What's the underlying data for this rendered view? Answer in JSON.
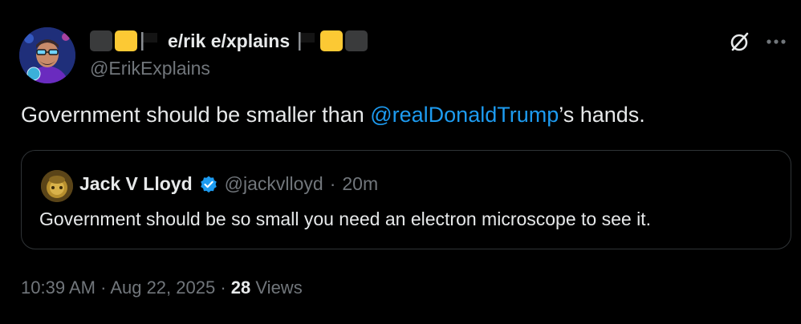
{
  "colors": {
    "background": "#000000",
    "text_primary": "#e7e9ea",
    "text_secondary": "#71767b",
    "link": "#1d9bf0",
    "verified": "#1d9bf0",
    "emoji_black": "#3a3b3c",
    "emoji_yellow": "#fcc934",
    "border": "#2f3336"
  },
  "tweet": {
    "author": {
      "display_name": "e/rik e/xplains",
      "handle": "@ErikExplains",
      "name_prefix_emoji": [
        "black-square-emoji",
        "yellow-square-emoji",
        "black-flag-emoji"
      ],
      "name_suffix_emoji": [
        "black-flag-emoji",
        "yellow-square-emoji",
        "black-square-emoji"
      ]
    },
    "icons": {
      "grok": "grok-icon",
      "more": "more-icon"
    },
    "text_before": "Government should be smaller than ",
    "mention": "@realDonaldTrump",
    "text_after": "’s hands.",
    "quoted": {
      "display_name": "Jack V Lloyd",
      "verified_icon": "verified-badge-icon",
      "handle": "@jackvlloyd",
      "separator": "·",
      "time": "20m",
      "text": "Government should be so small you need an electron microscope to see it."
    },
    "footer": {
      "time": "10:39 AM",
      "sep1": "·",
      "date": "Aug 22, 2025",
      "sep2": "·",
      "views_count": "28",
      "views_label": "Views"
    }
  }
}
